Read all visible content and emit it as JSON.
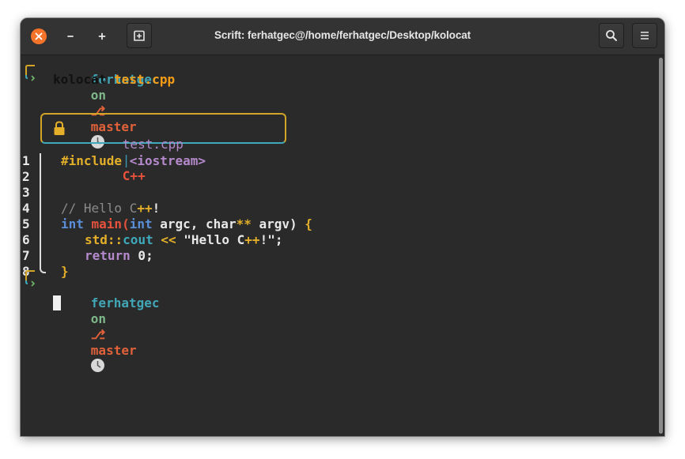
{
  "window": {
    "title": "Scrift: ferhatgec@/home/ferhatgec/Desktop/kolocat"
  },
  "prompt": {
    "user": "ferhatgec",
    "on": "on",
    "branch_symbol": "⎇",
    "branch": "master"
  },
  "command": {
    "program": "kolocat",
    "argument": "test.cpp"
  },
  "file_header": {
    "filename": "test.cpp",
    "separator": "|",
    "language": "C++"
  },
  "code": {
    "line_numbers": [
      "1",
      "2",
      "3",
      "4",
      "5",
      "6",
      "7",
      "8"
    ],
    "line1": {
      "a": "#include ",
      "b": "<iostream>"
    },
    "line4": {
      "a": "// Hello C",
      "b": "++",
      "c": "!"
    },
    "line5": {
      "a": "int ",
      "b": "main(",
      "c": "int",
      "d": " argc, char",
      "e": "**",
      "f": " argv) ",
      "g": "{"
    },
    "line6": {
      "a": "std::",
      "b": "cout",
      "c": " << ",
      "d": "\"Hello C",
      "e": "++",
      "f": "!\"",
      "g": ";"
    },
    "line7": {
      "a": "return",
      "b": " 0;"
    },
    "line8": {
      "a": "}"
    }
  },
  "colors": {
    "close_button": "#f37329",
    "user": "#41a6b5",
    "branch": "#e0613a",
    "box_top": "#d3a527",
    "box_bottom": "#3fa9bc"
  }
}
